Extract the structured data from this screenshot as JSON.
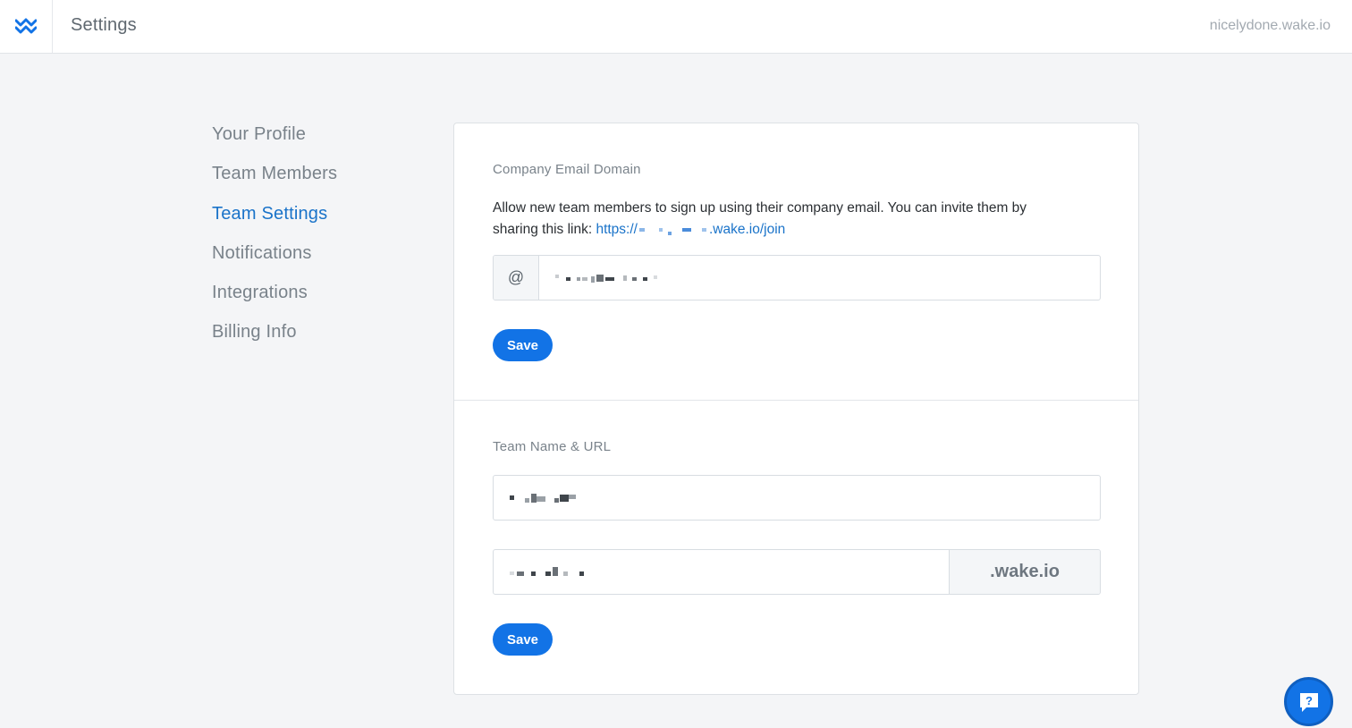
{
  "header": {
    "title": "Settings",
    "team_domain": "nicelydone.wake.io",
    "logo_icon": "wake-logo-icon"
  },
  "sidenav": {
    "items": [
      {
        "label": "Your Profile",
        "active": false
      },
      {
        "label": "Team Members",
        "active": false
      },
      {
        "label": "Team Settings",
        "active": true
      },
      {
        "label": "Notifications",
        "active": false
      },
      {
        "label": "Integrations",
        "active": false
      },
      {
        "label": "Billing Info",
        "active": false
      }
    ]
  },
  "email_domain": {
    "label": "Company Email Domain",
    "description": "Allow new team members to sign up using their company email. You can invite them by sharing this link:",
    "link_prefix": "https://",
    "link_suffix": ".wake.io/join",
    "at_symbol": "@",
    "save_label": "Save"
  },
  "team_name_url": {
    "label": "Team Name & URL",
    "url_suffix": ".wake.io",
    "save_label": "Save"
  },
  "help": {
    "icon": "help-question-icon"
  },
  "colors": {
    "accent": "#1273e6",
    "link": "#1a73c9",
    "background": "#f4f5f7"
  }
}
